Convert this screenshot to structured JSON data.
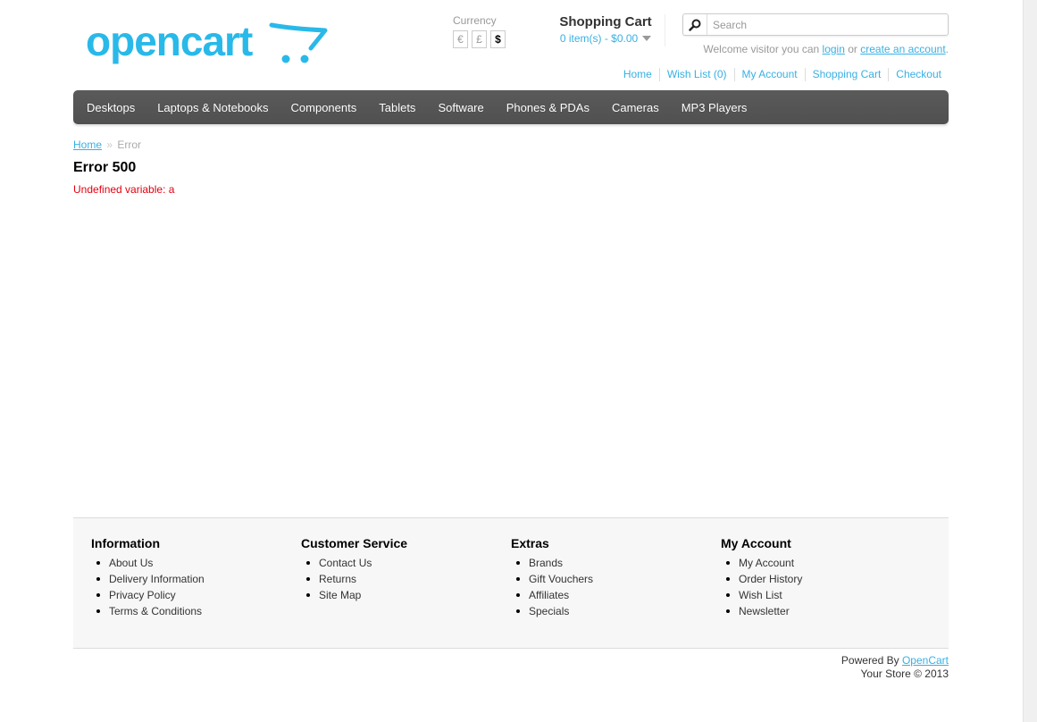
{
  "header": {
    "logo_alt": "opencart",
    "brand_color": "#29b9e9",
    "currency": {
      "label": "Currency",
      "options": [
        "€",
        "£",
        "$"
      ],
      "selected": "$"
    },
    "cart": {
      "heading": "Shopping Cart",
      "total": "0 item(s) - $0.00"
    },
    "search": {
      "placeholder": "Search",
      "value": ""
    },
    "welcome": {
      "prefix": "Welcome visitor you can ",
      "login": "login",
      "middle": " or ",
      "create_account": "create an account",
      "suffix": "."
    },
    "links": [
      "Home",
      "Wish List (0)",
      "My Account",
      "Shopping Cart",
      "Checkout"
    ]
  },
  "menu": {
    "items": [
      "Desktops",
      "Laptops & Notebooks",
      "Components",
      "Tablets",
      "Software",
      "Phones & PDAs",
      "Cameras",
      "MP3 Players"
    ]
  },
  "breadcrumb": {
    "home": "Home",
    "separator": "»",
    "current": "Error"
  },
  "content": {
    "title": "Error 500",
    "message": "Undefined variable: a"
  },
  "footer": {
    "columns": [
      {
        "title": "Information",
        "items": [
          "About Us",
          "Delivery Information",
          "Privacy Policy",
          "Terms & Conditions"
        ]
      },
      {
        "title": "Customer Service",
        "items": [
          "Contact Us",
          "Returns",
          "Site Map"
        ]
      },
      {
        "title": "Extras",
        "items": [
          "Brands",
          "Gift Vouchers",
          "Affiliates",
          "Specials"
        ]
      },
      {
        "title": "My Account",
        "items": [
          "My Account",
          "Order History",
          "Wish List",
          "Newsletter"
        ]
      }
    ]
  },
  "powered": {
    "prefix": "Powered By ",
    "link": "OpenCart",
    "copyright": "Your Store © 2013"
  },
  "colors": {
    "link": "#38b0e3",
    "menu_bg": "#555555",
    "error": "#e3000f",
    "footer_bg": "#f7f7f7"
  }
}
